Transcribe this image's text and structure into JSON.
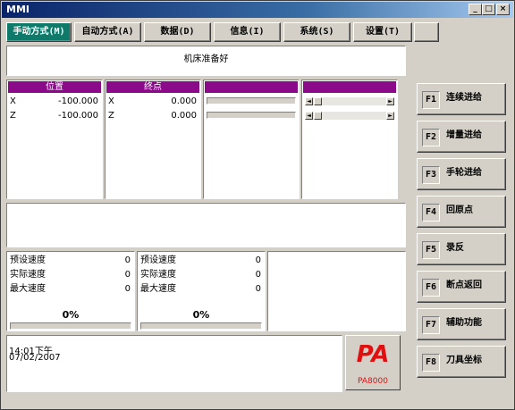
{
  "window": {
    "title": "MMI"
  },
  "tabs": [
    {
      "label": "手动方式(M)"
    },
    {
      "label": "自动方式(A)"
    },
    {
      "label": "数据(D)"
    },
    {
      "label": "信息(I)"
    },
    {
      "label": "系统(S)"
    },
    {
      "label": "设置(T)"
    },
    {
      "label": ""
    }
  ],
  "status": {
    "message": "机床准备好"
  },
  "position": {
    "header": "位置",
    "rows": [
      {
        "axis": "X",
        "value": "-100.000"
      },
      {
        "axis": "Z",
        "value": "-100.000"
      }
    ]
  },
  "endpoint": {
    "header": "终点",
    "rows": [
      {
        "axis": "X",
        "value": "0.000"
      },
      {
        "axis": "Z",
        "value": "0.000"
      }
    ]
  },
  "speed_panels": [
    {
      "rows": [
        {
          "label": "预设速度",
          "value": "0"
        },
        {
          "label": "实际速度",
          "value": "0"
        },
        {
          "label": "最大速度",
          "value": "0"
        }
      ],
      "percent": "0%",
      "progress": 0
    },
    {
      "rows": [
        {
          "label": "预设速度",
          "value": "0"
        },
        {
          "label": "实际速度",
          "value": "0"
        },
        {
          "label": "最大速度",
          "value": "0"
        }
      ],
      "percent": "0%",
      "progress": 0
    }
  ],
  "clock": {
    "time": "14:01下午",
    "date": "07/02/2007"
  },
  "logo": {
    "mark": "PA",
    "text": "PA8000",
    "color": "#e01010"
  },
  "fkeys": [
    {
      "key": "F1",
      "label": "连续进给"
    },
    {
      "key": "F2",
      "label": "增量进给"
    },
    {
      "key": "F3",
      "label": "手轮进给"
    },
    {
      "key": "F4",
      "label": "回原点"
    },
    {
      "key": "F5",
      "label": "录反"
    },
    {
      "key": "F6",
      "label": "断点返回"
    },
    {
      "key": "F7",
      "label": "辅助功能"
    },
    {
      "key": "F8",
      "label": "刀具坐标"
    }
  ],
  "colors": {
    "active_tab": "#0f7a6a",
    "column_header": "#8a0a8a",
    "title_bar": "#0a246a"
  }
}
